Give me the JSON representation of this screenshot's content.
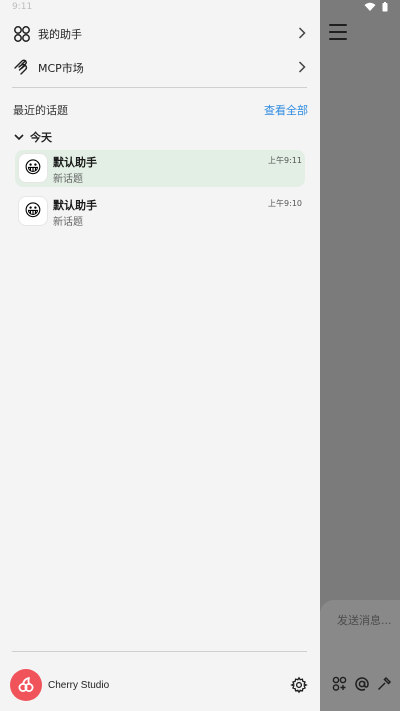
{
  "status": {
    "time": "9:11"
  },
  "sidebar": {
    "menu": [
      {
        "label": "我的助手",
        "icon": "assistants-icon"
      },
      {
        "label": "MCP市场",
        "icon": "mcp-icon"
      }
    ],
    "recent": {
      "title": "最近的话题",
      "see_all": "查看全部",
      "group_label": "今天",
      "topics": [
        {
          "assistant": "默认助手",
          "title": "新话题",
          "time": "上午9:11",
          "emoji": "😀",
          "active": true
        },
        {
          "assistant": "默认助手",
          "title": "新话题",
          "time": "上午9:10",
          "emoji": "😀",
          "active": false
        }
      ]
    },
    "profile": {
      "name": "Cherry Studio"
    }
  },
  "composer": {
    "placeholder": "发送消息..."
  },
  "colors": {
    "accent": "#2f8be0",
    "active_row": "#e3efe5",
    "logo": "#f0535a"
  }
}
